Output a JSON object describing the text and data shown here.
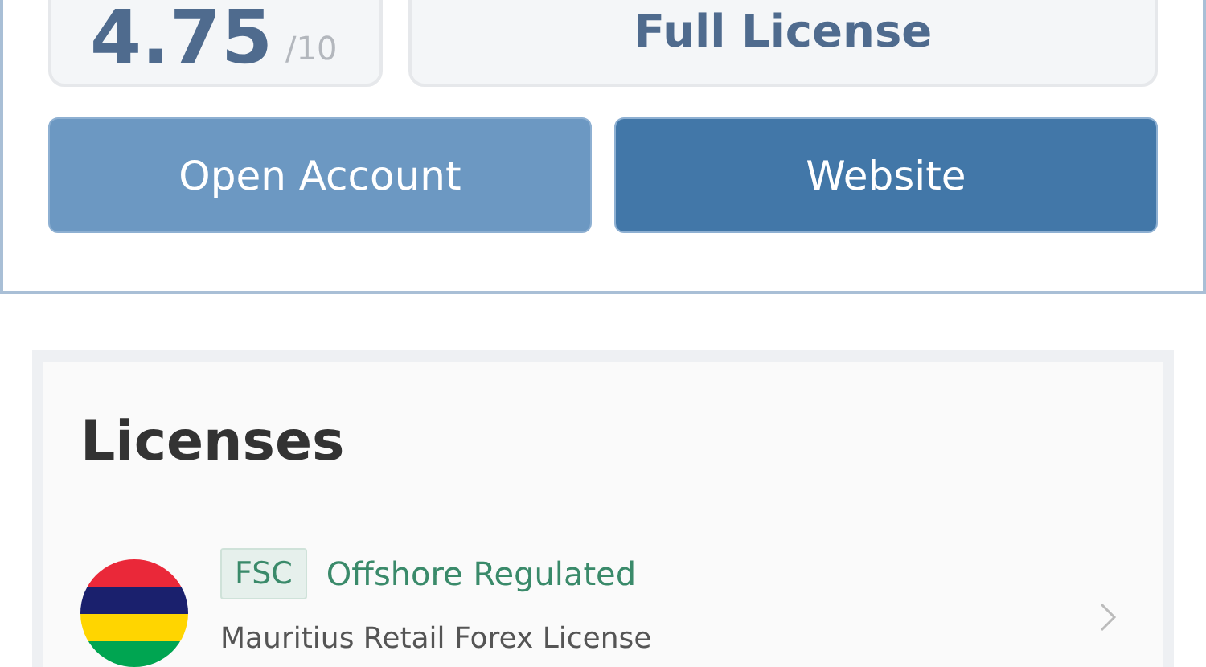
{
  "score": {
    "value": "4.75",
    "scale": "/10"
  },
  "license_status": "Full License",
  "buttons": [
    "Open Account",
    "Website"
  ],
  "licenses": {
    "title": "Licenses",
    "items": [
      {
        "badge": "FSC",
        "status": "Offshore Regulated",
        "name": "Mauritius Retail Forex License"
      }
    ]
  }
}
